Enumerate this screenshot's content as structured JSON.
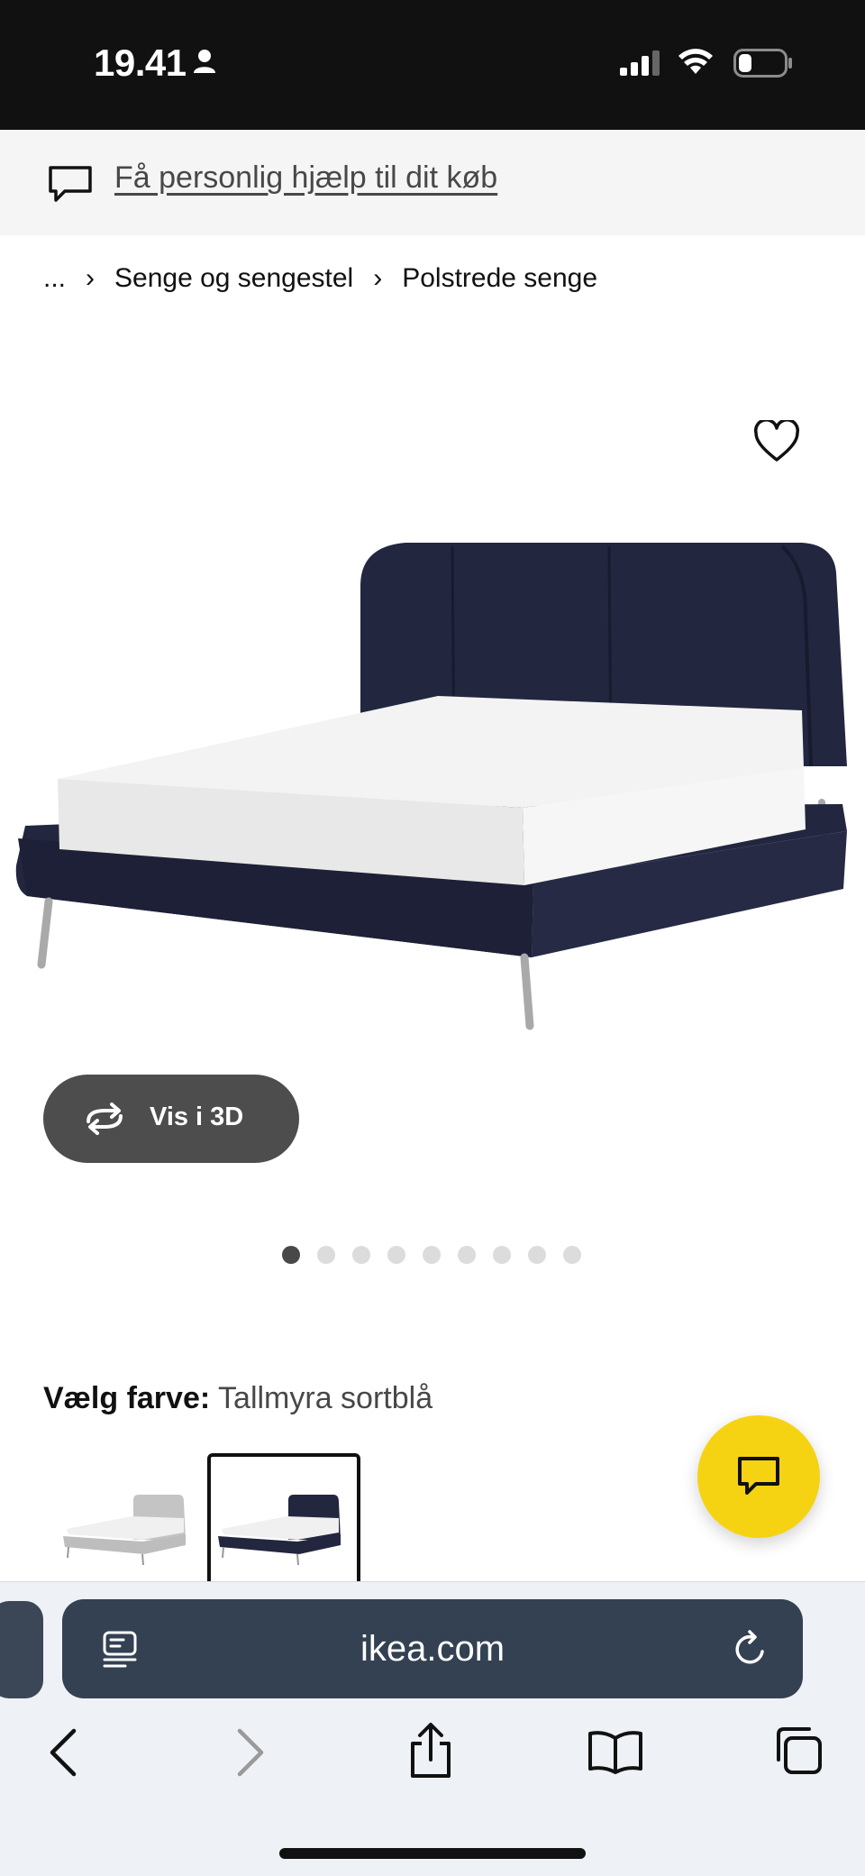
{
  "status_bar": {
    "time": "19.41",
    "icons": [
      "person-icon",
      "signal-icon",
      "wifi-icon",
      "battery-icon"
    ]
  },
  "help_banner": {
    "text": "Få personlig hjælp til dit køb",
    "icon": "chat-bubble-icon"
  },
  "breadcrumb": {
    "ellipsis": "...",
    "items": [
      "Senge og sengestel",
      "Polstrede senge"
    ],
    "separator": "›"
  },
  "product": {
    "view_3d_label": "Vis i 3D",
    "carousel": {
      "total": 9,
      "active_index": 0
    },
    "colors": {
      "sofa_blue": "#23263f",
      "mattress": "#f1f1f1",
      "legs": "#a9a9a9",
      "light_grey": "#c4c4c4"
    }
  },
  "color_chooser": {
    "label": "Vælg farve:",
    "value": "Tallmyra sortblå",
    "swatches": [
      {
        "name": "light-grey",
        "selected": false
      },
      {
        "name": "dark-blue",
        "selected": true
      }
    ]
  },
  "chat_fab": {
    "icon": "chat-icon",
    "color": "#f5d312"
  },
  "browser": {
    "url": "ikea.com",
    "icons": [
      "reader-icon",
      "reload-icon",
      "back-icon",
      "forward-icon",
      "share-icon",
      "bookmarks-icon",
      "tabs-icon"
    ]
  }
}
